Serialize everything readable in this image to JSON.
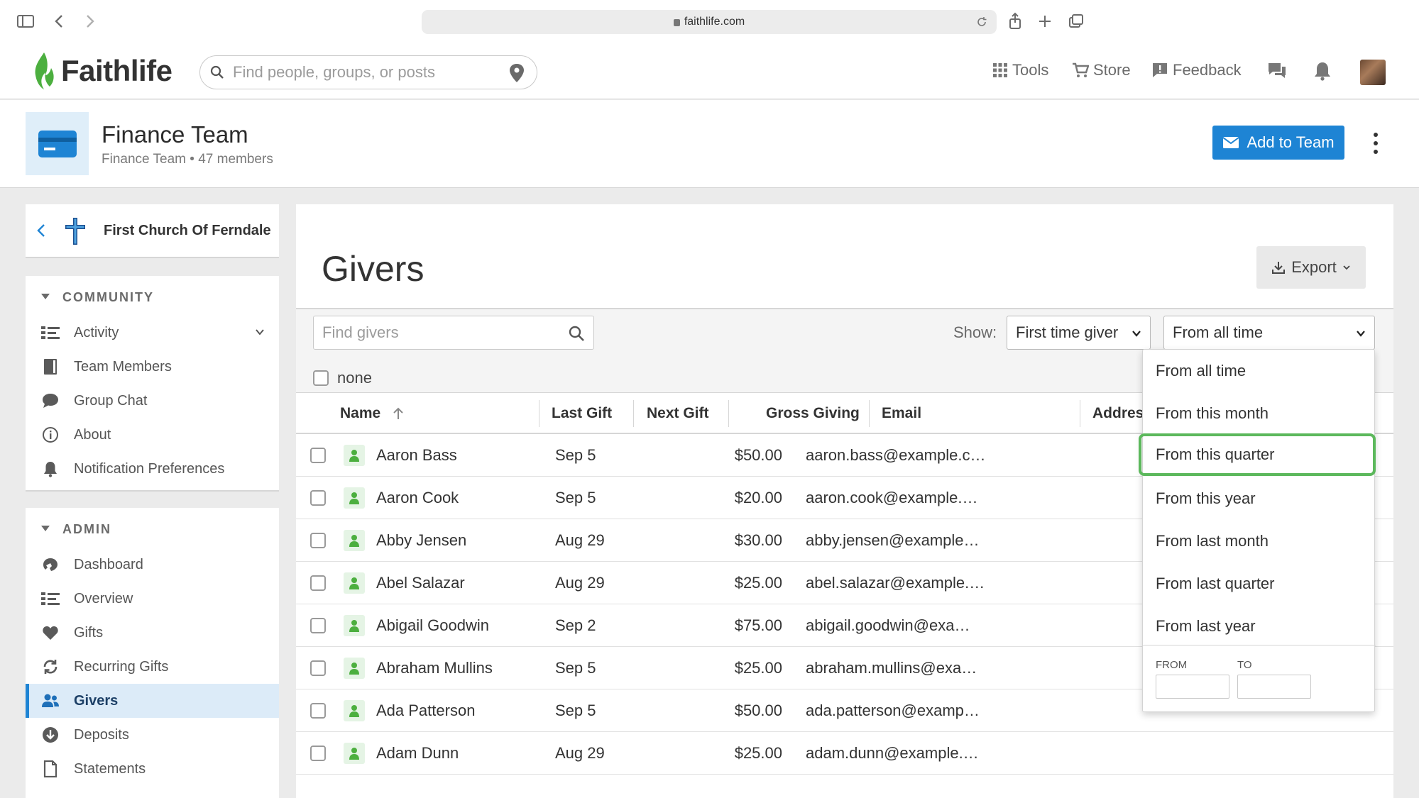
{
  "browser": {
    "url": "faithlife.com"
  },
  "header": {
    "logo_text": "Faithlife",
    "search_placeholder": "Find people, groups, or posts",
    "nav": {
      "tools": "Tools",
      "store": "Store",
      "feedback": "Feedback"
    }
  },
  "group": {
    "title": "Finance Team",
    "subtitle_name": "Finance Team",
    "member_count": "47 members",
    "add_button": "Add to Team"
  },
  "sidebar": {
    "church": "First Church Of Ferndale",
    "community_title": "COMMUNITY",
    "community_items": [
      {
        "label": "Activity",
        "icon": "list-icon"
      },
      {
        "label": "Team Members",
        "icon": "book-icon"
      },
      {
        "label": "Group Chat",
        "icon": "chat-icon"
      },
      {
        "label": "About",
        "icon": "info-icon"
      },
      {
        "label": "Notification Preferences",
        "icon": "bell-icon"
      }
    ],
    "admin_title": "ADMIN",
    "admin_items": [
      {
        "label": "Dashboard",
        "icon": "dashboard-icon"
      },
      {
        "label": "Overview",
        "icon": "list-icon"
      },
      {
        "label": "Gifts",
        "icon": "heart-icon"
      },
      {
        "label": "Recurring Gifts",
        "icon": "recurring-icon"
      },
      {
        "label": "Givers",
        "icon": "people-icon"
      },
      {
        "label": "Deposits",
        "icon": "deposit-icon"
      },
      {
        "label": "Statements",
        "icon": "document-icon"
      }
    ],
    "active_item": "Givers"
  },
  "main": {
    "title": "Givers",
    "export_label": "Export",
    "find_placeholder": "Find givers",
    "show_label": "Show:",
    "filter_type": "First time giver",
    "filter_range": "From all time",
    "select_none_label": "none",
    "columns": [
      "Name",
      "Last Gift",
      "Next Gift",
      "Gross Giving",
      "Email",
      "Addres"
    ],
    "rows": [
      {
        "name": "Aaron Bass",
        "last_gift": "Sep 5",
        "gross": "$50.00",
        "email": "aaron.bass@example.c…"
      },
      {
        "name": "Aaron Cook",
        "last_gift": "Sep 5",
        "gross": "$20.00",
        "email": "aaron.cook@example.…"
      },
      {
        "name": "Abby Jensen",
        "last_gift": "Aug 29",
        "gross": "$30.00",
        "email": "abby.jensen@example…"
      },
      {
        "name": "Abel Salazar",
        "last_gift": "Aug 29",
        "gross": "$25.00",
        "email": "abel.salazar@example.…"
      },
      {
        "name": "Abigail Goodwin",
        "last_gift": "Sep 2",
        "gross": "$75.00",
        "email": "abigail.goodwin@exa…"
      },
      {
        "name": "Abraham Mullins",
        "last_gift": "Sep 5",
        "gross": "$25.00",
        "email": "abraham.mullins@exa…"
      },
      {
        "name": "Ada Patterson",
        "last_gift": "Sep 5",
        "gross": "$50.00",
        "email": "ada.patterson@examp…"
      },
      {
        "name": "Adam Dunn",
        "last_gift": "Aug 29",
        "gross": "$25.00",
        "email": "adam.dunn@example.…"
      }
    ]
  },
  "range_dropdown": {
    "options": [
      "From all time",
      "From this month",
      "From this quarter",
      "From this year",
      "From last month",
      "From last quarter",
      "From last year"
    ],
    "highlighted": "From this quarter",
    "from_label": "FROM",
    "to_label": "TO"
  },
  "colors": {
    "accent": "#1e84d4",
    "highlight": "#5cb85c",
    "active_bg": "#dcebf8"
  }
}
